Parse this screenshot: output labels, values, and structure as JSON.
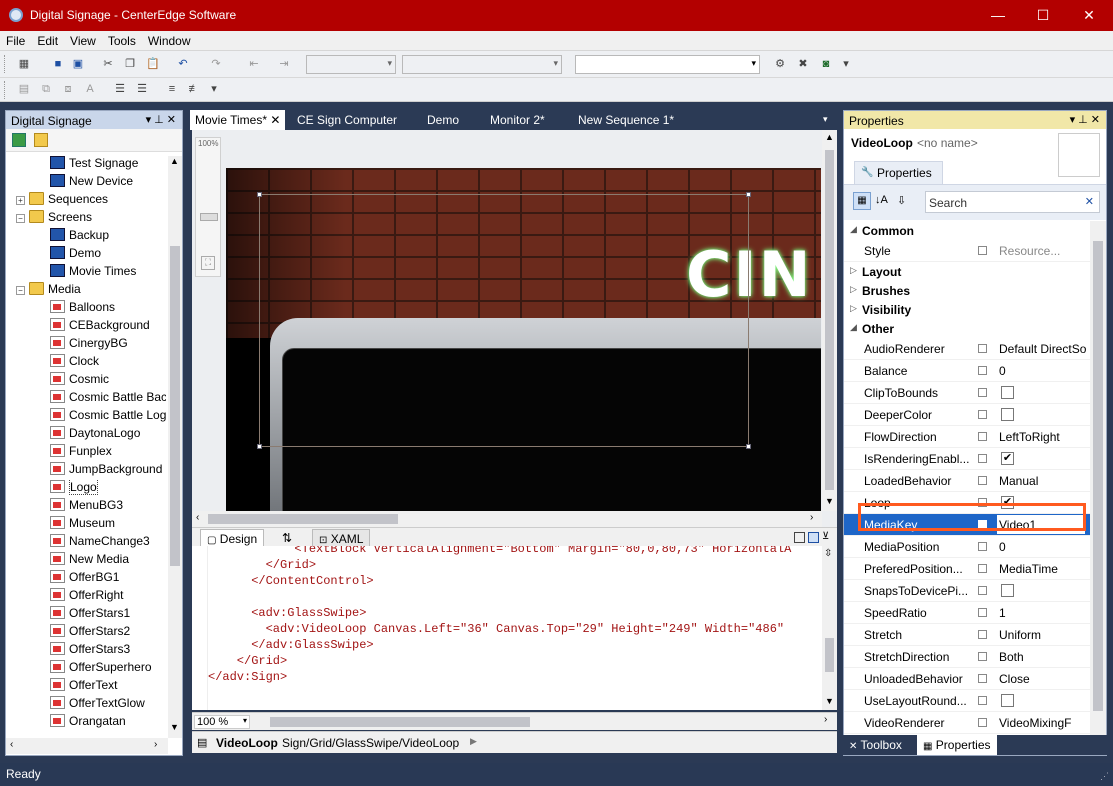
{
  "window": {
    "title": "Digital Signage - CenterEdge Software",
    "minimize": "—",
    "maximize": "☐",
    "close": "✕"
  },
  "menu": [
    "File",
    "Edit",
    "View",
    "Tools",
    "Window"
  ],
  "left_panel": {
    "title": "Digital Signage",
    "pin": "▾ ⊥ ✕",
    "items": [
      {
        "label": "Test Signage",
        "icon": "screen-icon"
      },
      {
        "label": "New Device",
        "icon": "screen-icon"
      },
      {
        "label": "Sequences",
        "icon": "folder-icon",
        "expander": "+"
      },
      {
        "label": "Screens",
        "icon": "folder-icon",
        "expander": "−"
      },
      {
        "label": "Backup",
        "icon": "screen-icon"
      },
      {
        "label": "Demo",
        "icon": "screen-icon"
      },
      {
        "label": "Movie Times",
        "icon": "screen-icon"
      },
      {
        "label": "Media",
        "icon": "folder-icon",
        "expander": "−"
      },
      {
        "label": "Balloons",
        "icon": "file-icon"
      },
      {
        "label": "CEBackground",
        "icon": "file-icon"
      },
      {
        "label": "CinergyBG",
        "icon": "file-icon"
      },
      {
        "label": "Clock",
        "icon": "file-icon"
      },
      {
        "label": "Cosmic",
        "icon": "file-icon"
      },
      {
        "label": "Cosmic Battle Bac",
        "icon": "file-icon"
      },
      {
        "label": "Cosmic Battle Log",
        "icon": "file-icon"
      },
      {
        "label": "DaytonaLogo",
        "icon": "file-icon"
      },
      {
        "label": "Funplex",
        "icon": "file-icon"
      },
      {
        "label": "JumpBackground",
        "icon": "file-icon"
      },
      {
        "label": "Logo",
        "icon": "file-icon"
      },
      {
        "label": "MenuBG3",
        "icon": "file-icon"
      },
      {
        "label": "Museum",
        "icon": "file-icon"
      },
      {
        "label": "NameChange3",
        "icon": "file-icon"
      },
      {
        "label": "New Media",
        "icon": "file-icon"
      },
      {
        "label": "OfferBG1",
        "icon": "file-icon"
      },
      {
        "label": "OfferRight",
        "icon": "file-icon"
      },
      {
        "label": "OfferStars1",
        "icon": "file-icon"
      },
      {
        "label": "OfferStars2",
        "icon": "file-icon"
      },
      {
        "label": "OfferStars3",
        "icon": "file-icon"
      },
      {
        "label": "OfferSuperhero",
        "icon": "file-icon"
      },
      {
        "label": "OfferText",
        "icon": "file-icon"
      },
      {
        "label": "OfferTextGlow",
        "icon": "file-icon"
      },
      {
        "label": "Orangatan",
        "icon": "file-icon"
      }
    ]
  },
  "doc_tabs": [
    {
      "label": "Movie Times*",
      "active": true
    },
    {
      "label": "CE Sign Computer",
      "active": false
    },
    {
      "label": "Demo",
      "active": false
    },
    {
      "label": "Monitor 2*",
      "active": false
    },
    {
      "label": "New Sequence 1*",
      "active": false
    }
  ],
  "designer": {
    "zoom_label": "100%",
    "canvas_text": "CIN"
  },
  "xaml_tabs": {
    "design": "Design",
    "swap": "⇅",
    "xaml": "XAML"
  },
  "code_lines": [
    "            <TextBlock VerticalAlignment=\"Bottom\" Margin=\"80,0,80,73\" HorizontalA",
    "        </Grid>",
    "      </ContentControl>",
    "",
    "      <adv:GlassSwipe>",
    "        <adv:VideoLoop Canvas.Left=\"36\" Canvas.Top=\"29\" Height=\"249\" Width=\"486\"",
    "      </adv:GlassSwipe>",
    "    </Grid>",
    "</adv:Sign>"
  ],
  "zoom": {
    "value": "100 %"
  },
  "breadcrumb": {
    "current": "VideoLoop",
    "path": "Sign/Grid/GlassSwipe/VideoLoop"
  },
  "properties": {
    "title": "Properties",
    "element_type": "VideoLoop",
    "element_name": "<no name>",
    "tab": "Properties",
    "search_placeholder": "Search",
    "categories": {
      "common": "Common",
      "layout": "Layout",
      "brushes": "Brushes",
      "visibility": "Visibility",
      "other": "Other"
    },
    "style": {
      "name": "Style",
      "value": "Resource..."
    },
    "rows": [
      {
        "name": "AudioRenderer",
        "value": "Default DirectSo"
      },
      {
        "name": "Balance",
        "value": "0"
      },
      {
        "name": "ClipToBounds",
        "check": false
      },
      {
        "name": "DeeperColor",
        "check": false
      },
      {
        "name": "FlowDirection",
        "value": "LeftToRight"
      },
      {
        "name": "IsRenderingEnabl...",
        "check": true
      },
      {
        "name": "LoadedBehavior",
        "value": "Manual"
      },
      {
        "name": "Loop",
        "check": true
      },
      {
        "name": "MediaKey",
        "value": "Video1",
        "selected": true
      },
      {
        "name": "MediaPosition",
        "value": "0"
      },
      {
        "name": "PreferedPosition...",
        "value": "MediaTime"
      },
      {
        "name": "SnapsToDevicePi...",
        "check": false
      },
      {
        "name": "SpeedRatio",
        "value": "1"
      },
      {
        "name": "Stretch",
        "value": "Uniform"
      },
      {
        "name": "StretchDirection",
        "value": "Both"
      },
      {
        "name": "UnloadedBehavior",
        "value": "Close"
      },
      {
        "name": "UseLayoutRound...",
        "check": false
      },
      {
        "name": "VideoRenderer",
        "value": "VideoMixingF"
      }
    ]
  },
  "bottom_tabs": {
    "toolbox": "Toolbox",
    "properties": "Properties"
  },
  "status": {
    "text": "Ready"
  },
  "colors": {
    "titlebar": "#b30000",
    "chrome": "#2b3a55",
    "highlight": "#ff5a1f",
    "selection": "#1e66c8"
  }
}
